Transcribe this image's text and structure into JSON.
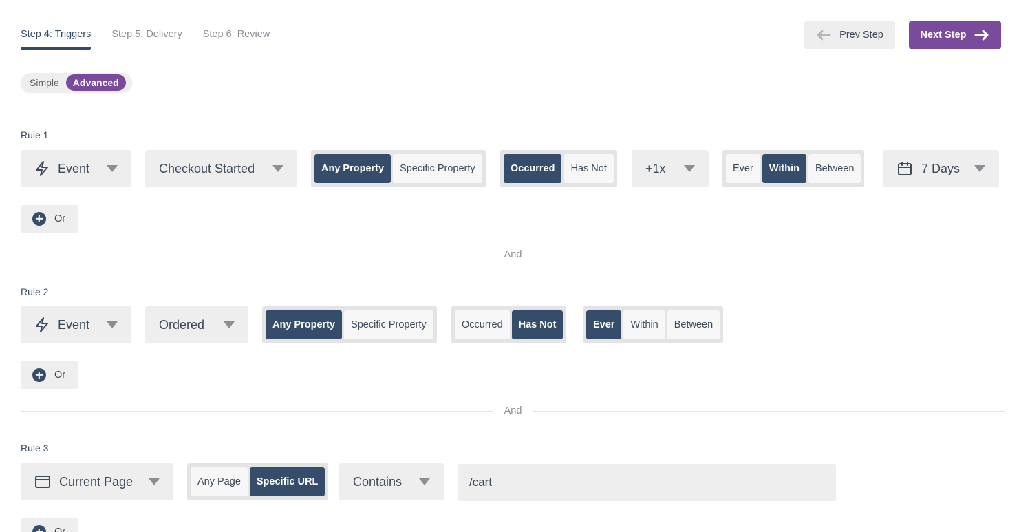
{
  "header": {
    "tabs": [
      {
        "label": "Step 4: Triggers",
        "active": true
      },
      {
        "label": "Step 5: Delivery",
        "active": false
      },
      {
        "label": "Step 6: Review",
        "active": false
      }
    ],
    "prev_label": "Prev Step",
    "next_label": "Next Step"
  },
  "mode": {
    "simple": "Simple",
    "advanced": "Advanced",
    "selected": "Advanced"
  },
  "rules": [
    {
      "label": "Rule 1",
      "type": "Event",
      "event": "Checkout Started",
      "property": {
        "options": [
          "Any Property",
          "Specific Property"
        ],
        "selected": "Any Property"
      },
      "occurrence": {
        "options": [
          "Occurred",
          "Has Not"
        ],
        "selected": "Occurred"
      },
      "count": "+1x",
      "timeframe": {
        "options": [
          "Ever",
          "Within",
          "Between"
        ],
        "selected": "Within"
      },
      "duration": "7 Days",
      "or_label": "Or"
    },
    {
      "label": "Rule 2",
      "type": "Event",
      "event": "Ordered",
      "property": {
        "options": [
          "Any Property",
          "Specific Property"
        ],
        "selected": "Any Property"
      },
      "occurrence": {
        "options": [
          "Occurred",
          "Has Not"
        ],
        "selected": "Has Not"
      },
      "timeframe": {
        "options": [
          "Ever",
          "Within",
          "Between"
        ],
        "selected": "Ever"
      },
      "or_label": "Or"
    },
    {
      "label": "Rule 3",
      "type": "Current Page",
      "page": {
        "options": [
          "Any Page",
          "Specific URL"
        ],
        "selected": "Specific URL"
      },
      "match": "Contains",
      "url_value": "/cart",
      "or_label": "Or"
    }
  ],
  "and_label": "And",
  "colors": {
    "primary": "#354d6b",
    "accent": "#7a4a9c",
    "control_bg": "#eeeeee"
  }
}
